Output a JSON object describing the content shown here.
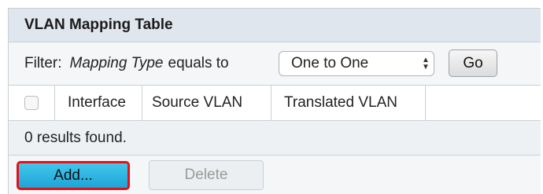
{
  "table": {
    "title": "VLAN Mapping Table",
    "filter": {
      "label": "Filter:",
      "field": "Mapping Type",
      "operator": "equals to",
      "selected_value": "One to One",
      "go_label": "Go"
    },
    "columns": [
      "Interface",
      "Source VLAN",
      "Translated VLAN"
    ],
    "results_text": "0 results found.",
    "buttons": {
      "add_label": "Add...",
      "delete_label": "Delete"
    }
  },
  "colors": {
    "add_button": "#1fa5d7",
    "highlight_border": "#e2121a"
  },
  "icons": {
    "select_arrows": "chevron-up-down-icon"
  }
}
